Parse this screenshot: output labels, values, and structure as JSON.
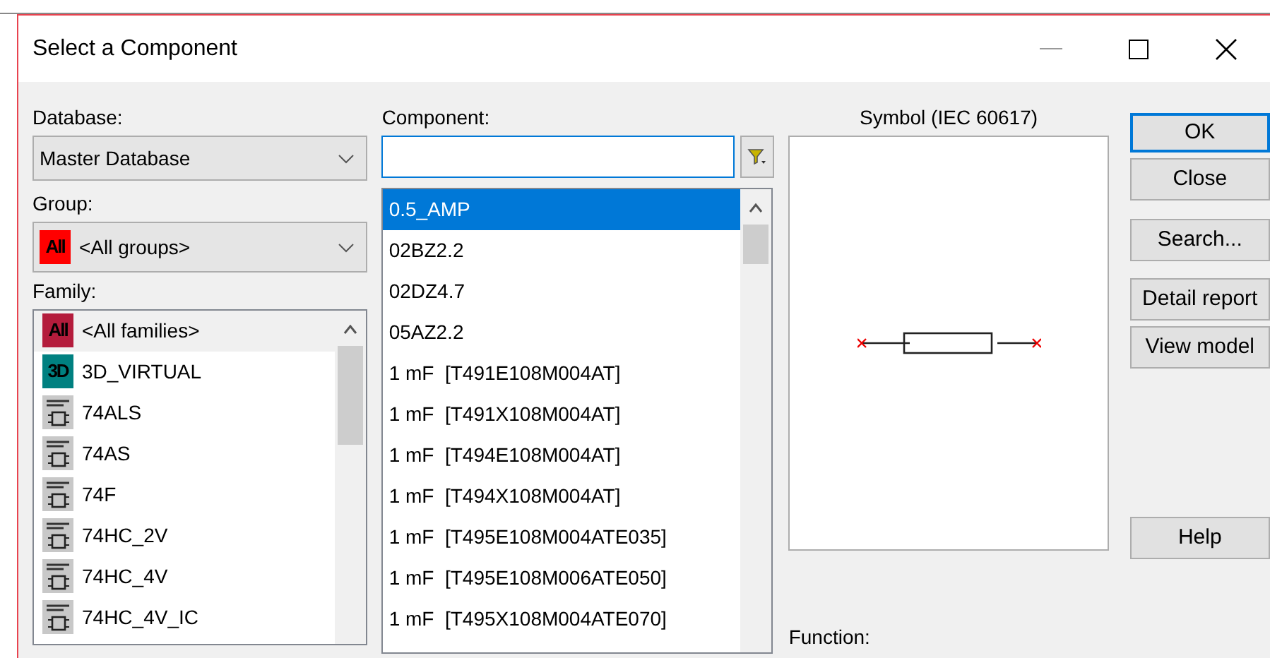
{
  "window": {
    "title": "Select a Component"
  },
  "database": {
    "label": "Database:",
    "value": "Master Database"
  },
  "group": {
    "label": "Group:",
    "badge": "All",
    "color": "#ff0000",
    "value": "<All groups>"
  },
  "family": {
    "label": "Family:",
    "items": [
      {
        "kind": "badge",
        "badge": "All",
        "color": "#b41c3c",
        "text": "<All families>",
        "selected": true
      },
      {
        "kind": "badge",
        "badge": "3D",
        "color": "#008080",
        "text": "3D_VIRTUAL",
        "selected": false
      },
      {
        "kind": "chip",
        "text": "74ALS",
        "selected": false
      },
      {
        "kind": "chip",
        "text": "74AS",
        "selected": false
      },
      {
        "kind": "chip",
        "text": "74F",
        "selected": false
      },
      {
        "kind": "chip",
        "text": "74HC_2V",
        "selected": false
      },
      {
        "kind": "chip",
        "text": "74HC_4V",
        "selected": false
      },
      {
        "kind": "chip",
        "text": "74HC_4V_IC",
        "selected": false
      }
    ]
  },
  "component": {
    "label": "Component:",
    "items": [
      {
        "text": "0.5_AMP",
        "selected": true
      },
      {
        "text": "02BZ2.2",
        "selected": false
      },
      {
        "text": "02DZ4.7",
        "selected": false
      },
      {
        "text": "05AZ2.2",
        "selected": false
      },
      {
        "text": "1 mF  [T491E108M004AT]",
        "selected": false
      },
      {
        "text": "1 mF  [T491X108M004AT]",
        "selected": false
      },
      {
        "text": "1 mF  [T494E108M004AT]",
        "selected": false
      },
      {
        "text": "1 mF  [T494X108M004AT]",
        "selected": false
      },
      {
        "text": "1 mF  [T495E108M004ATE035]",
        "selected": false
      },
      {
        "text": "1 mF  [T495E108M006ATE050]",
        "selected": false
      },
      {
        "text": "1 mF  [T495X108M004ATE070]",
        "selected": false
      }
    ]
  },
  "symbol": {
    "label": "Symbol (IEC 60617)"
  },
  "function": {
    "label": "Function:"
  },
  "buttons": [
    {
      "label": "OK",
      "default": true
    },
    {
      "label": "Close",
      "default": false
    },
    {
      "label": "Search...",
      "default": false
    },
    {
      "label": "Detail report",
      "default": false
    },
    {
      "label": "View model",
      "default": false
    },
    {
      "label": "Help",
      "default": false
    }
  ]
}
